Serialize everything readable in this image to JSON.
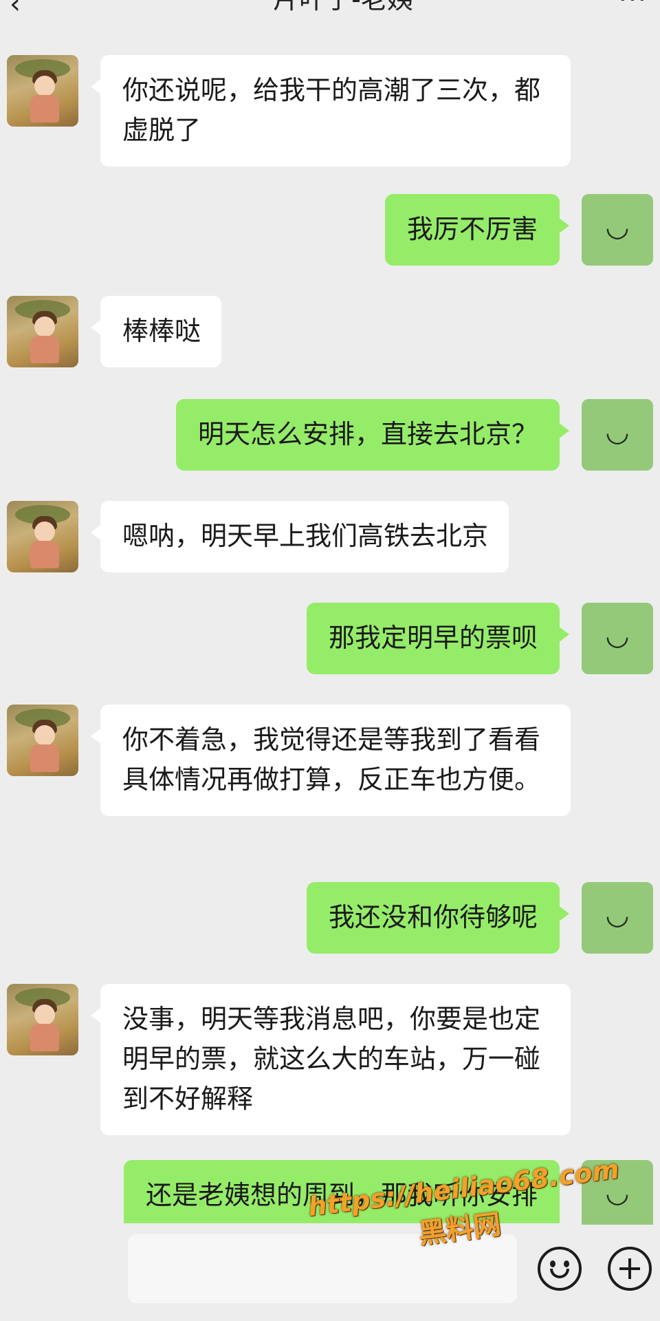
{
  "header": {
    "title": "一片叶子-老姨",
    "back_icon": "‹",
    "more_icon": "···"
  },
  "messages": [
    {
      "side": "left",
      "text": "你还说呢，给我干的高潮了三次，都虚脱了"
    },
    {
      "side": "right",
      "text": "我厉不厉害"
    },
    {
      "side": "left",
      "text": "棒棒哒"
    },
    {
      "side": "right",
      "text": "明天怎么安排，直接去北京？"
    },
    {
      "side": "left",
      "text": "嗯呐，明天早上我们高铁去北京"
    },
    {
      "side": "right",
      "text": "那我定明早的票呗"
    },
    {
      "side": "left",
      "text": "你不着急，我觉得还是等我到了看看具体情况再做打算，反正车也方便。"
    },
    {
      "side": "right",
      "text": "我还没和你待够呢"
    },
    {
      "side": "left",
      "text": "没事，明天等我消息吧，你要是也定明早的票，就这么大的车站，万一碰到不好解释"
    },
    {
      "side": "right",
      "text": "还是老姨想的周到，那我听你安排"
    }
  ],
  "avatar_right_glyph": "◡",
  "watermark": {
    "url": "https://heiliao68.com",
    "name": "黑料网"
  },
  "icons": {
    "back": "chevron-left-icon",
    "more": "more-icon",
    "emoji": "emoji-icon",
    "plus": "plus-icon"
  },
  "colors": {
    "background": "#ededed",
    "bubble_sent": "#95ec69",
    "bubble_received": "#ffffff"
  }
}
